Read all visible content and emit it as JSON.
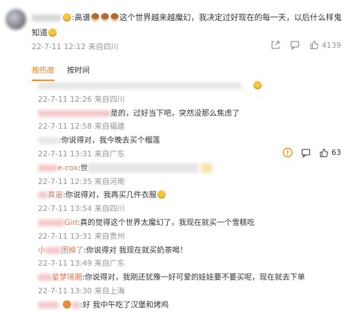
{
  "post": {
    "text_prefix": ":高谱",
    "text_body": "这个世界越来越魔幻，我决定过好现在的每一天，以后什么样鬼知道",
    "meta": "22-7-11 12:12 来自四川",
    "likes": "4139"
  },
  "tabs": [
    {
      "label": "按热度",
      "active": true
    },
    {
      "label": "按时间",
      "active": false
    }
  ],
  "comments": [
    {
      "meta": "22-7-11 12:26 来自四川",
      "text": "是的，过好当下吧，突然没那么焦虑了"
    },
    {
      "meta": "22-7-11 12:58 来自福建",
      "text": ":你说得对，我今晚去买个榴莲"
    },
    {
      "meta": "22-7-11 13:31 来自广东",
      "name_suffix": "e-cox",
      "text": ":世"
    },
    {
      "meta": "22-7-11 12:35 来自河南",
      "name_suffix": "真宙",
      "text": ":你说得对，我再买几件衣服"
    },
    {
      "meta": "22-7-11 13:54 来自四川",
      "name_suffix": "Girl",
      "text": ":真的觉得这个世界太魔幻了，我现在就买一个雪糕吃"
    },
    {
      "meta": "22-7-11 13:31 来自贵州",
      "name_prefix": "小",
      "name_suffix": "困掉了",
      "text": ":你说得对 我现在就买奶茶喝！"
    },
    {
      "meta": "22-7-11 13:49 来自广东",
      "name_suffix": "星梦境期",
      "text": ":你说得对，我刚还犹豫一好可爱的娃娃要不要买呢，现在就去下单"
    },
    {
      "meta": "22-7-11 13:30 来自上海",
      "text": ":好 我中午吃了汉堡和烤鸡"
    }
  ],
  "side_actions": {
    "like_count": "63"
  },
  "colors": {
    "accent": "#ff8200",
    "username": "#eb7350",
    "meta": "#939393"
  }
}
